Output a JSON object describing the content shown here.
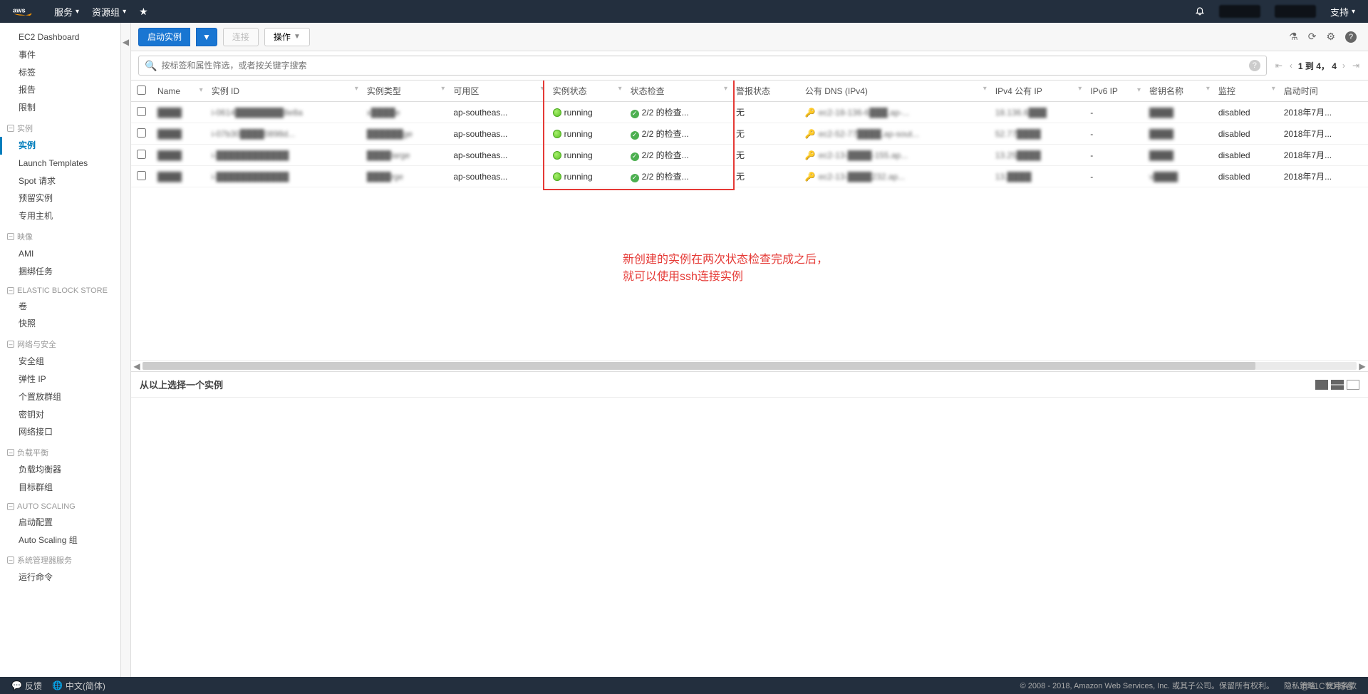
{
  "topnav": {
    "services": "服务",
    "resource_groups": "资源组",
    "support": "支持"
  },
  "sidebar": {
    "top": [
      "EC2 Dashboard",
      "事件",
      "标签",
      "报告",
      "限制"
    ],
    "groups": [
      {
        "title": "实例",
        "items": [
          "实例",
          "Launch Templates",
          "Spot 请求",
          "预留实例",
          "专用主机"
        ],
        "activeIndex": 0
      },
      {
        "title": "映像",
        "items": [
          "AMI",
          "捆绑任务"
        ]
      },
      {
        "title": "ELASTIC BLOCK STORE",
        "items": [
          "卷",
          "快照"
        ]
      },
      {
        "title": "网络与安全",
        "items": [
          "安全组",
          "弹性 IP",
          "个置放群组",
          "密钥对",
          "网络接口"
        ]
      },
      {
        "title": "负载平衡",
        "items": [
          "负载均衡器",
          "目标群组"
        ]
      },
      {
        "title": "AUTO SCALING",
        "items": [
          "启动配置",
          "Auto Scaling 组"
        ]
      },
      {
        "title": "系统管理器服务",
        "items": [
          "运行命令"
        ]
      }
    ]
  },
  "toolbar": {
    "launch": "启动实例",
    "connect": "连接",
    "actions": "操作"
  },
  "search": {
    "placeholder": "按标签和属性筛选，或者按关键字搜索"
  },
  "pager": {
    "range": "1 到 4，",
    "total": "4"
  },
  "columns": {
    "name": "Name",
    "instance_id": "实例 ID",
    "instance_type": "实例类型",
    "az": "可用区",
    "state": "实例状态",
    "status_check": "状态检查",
    "alarm": "警报状态",
    "public_dns": "公有 DNS (IPv4)",
    "public_ip": "IPv4 公有 IP",
    "ipv6": "IPv6 IP",
    "key_name": "密钥名称",
    "monitoring": "监控",
    "launch_time": "启动时间"
  },
  "rows": [
    {
      "name": "████",
      "id": "i-0614████████8e8a",
      "type": "x████e",
      "az": "ap-southeas...",
      "state": "running",
      "check": "2/2 的检查...",
      "alarm": "无",
      "dns": "ec2-18-136-6███.ap-...",
      "ip": "18.136.6███",
      "ipv6": "-",
      "key": "████",
      "monitoring": "disabled",
      "launch": "2018年7月..."
    },
    {
      "name": "████",
      "id": "i-07b30████0898d...",
      "type": "██████ge",
      "az": "ap-southeas...",
      "state": "running",
      "check": "2/2 的检查...",
      "alarm": "无",
      "dns": "ec2-52-77████.ap-sout...",
      "ip": "52.77████",
      "ipv6": "-",
      "key": "████",
      "monitoring": "disabled",
      "launch": "2018年7月..."
    },
    {
      "name": "████",
      "id": "i-████████████",
      "type": "████large",
      "az": "ap-southeas...",
      "state": "running",
      "check": "2/2 的检查...",
      "alarm": "无",
      "dns": "ec2-13-████-155.ap...",
      "ip": "13.25████",
      "ipv6": "-",
      "key": "████",
      "monitoring": "disabled",
      "launch": "2018年7月..."
    },
    {
      "name": "████",
      "id": "i-████████████",
      "type": "████rge",
      "az": "ap-southeas...",
      "state": "running",
      "check": "2/2 的检查...",
      "alarm": "无",
      "dns": "ec2-13-████232.ap...",
      "ip": "13.████",
      "ipv6": "-",
      "key": "v████",
      "monitoring": "disabled",
      "launch": "2018年7月..."
    }
  ],
  "annotation": {
    "line1": "新创建的实例在两次状态检查完成之后，",
    "line2": "就可以使用ssh连接实例"
  },
  "detail": {
    "title": "从以上选择一个实例"
  },
  "footer": {
    "feedback": "反馈",
    "language": "中文(简体)",
    "copyright": "© 2008 - 2018, Amazon Web Services, Inc. 或其子公司。保留所有权利。",
    "privacy": "隐私策略",
    "terms": "使用条款",
    "watermark": "@51CTO博客"
  }
}
